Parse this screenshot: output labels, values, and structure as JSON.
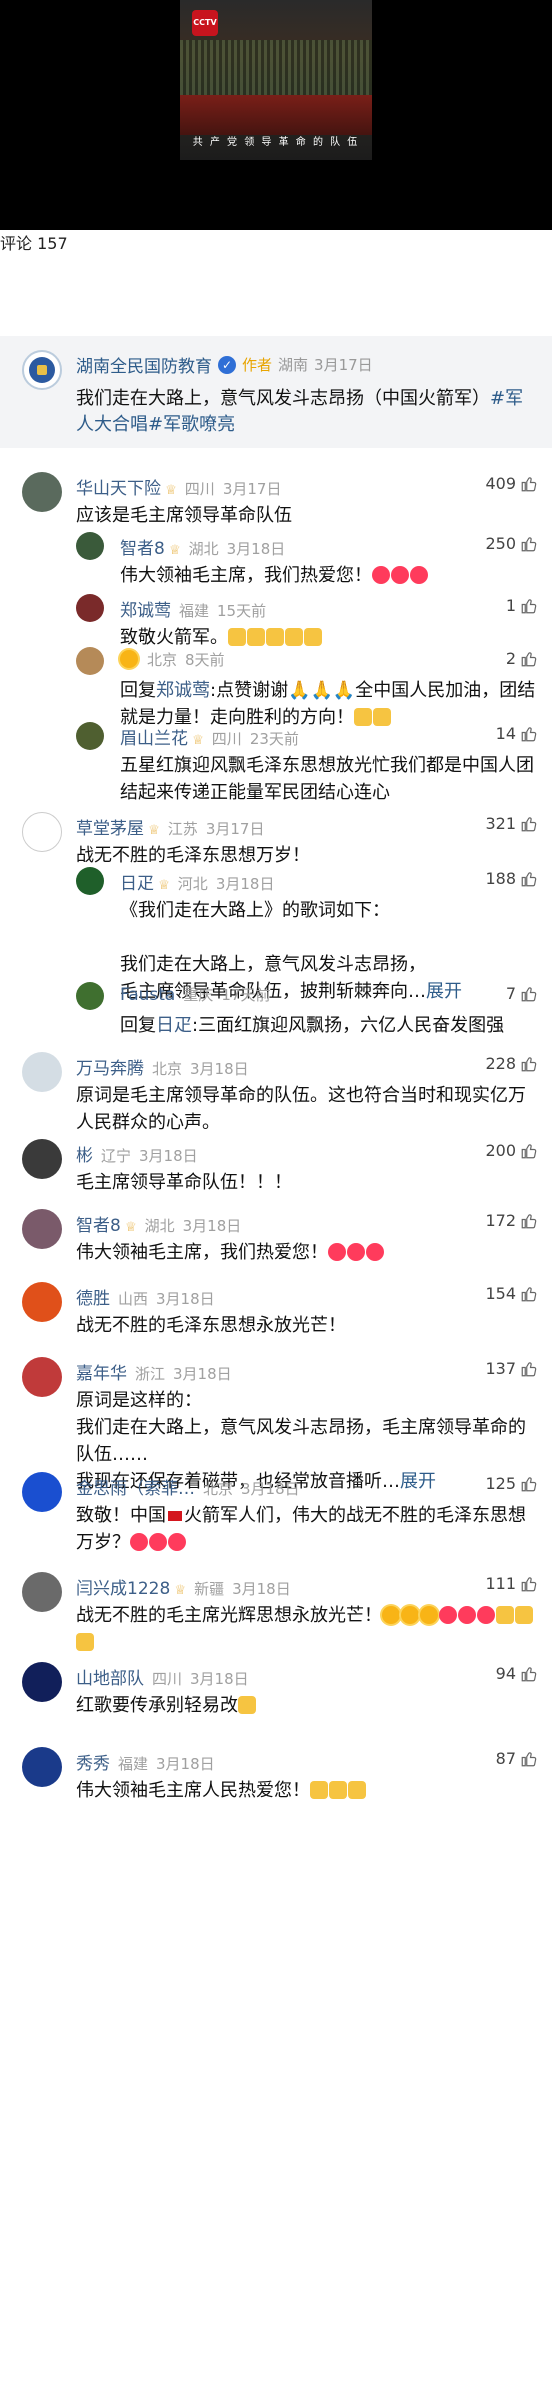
{
  "video": {
    "subtitle": "共 产 党 领 导 革 命 的 队 伍",
    "badge": "CCTV"
  },
  "header": {
    "title": "评论 157"
  },
  "author_post": {
    "name": "湖南全民国防教育",
    "tag": "作者",
    "location": "湖南",
    "date": "3月17日",
    "text": "我们走在大路上，意气风发斗志昂扬（中国火箭军）",
    "hashtags": "#军人大合唱#军歌嘹亮"
  },
  "comments": [
    {
      "name": "华山天下险",
      "crown": true,
      "location": "四川",
      "date": "3月17日",
      "likes": "409",
      "text": "应该是毛主席领导革命队伍",
      "level": 0
    },
    {
      "name": "智者8",
      "crown": true,
      "location": "湖北",
      "date": "3月18日",
      "likes": "250",
      "text": "伟大领袖毛主席，我们热爱您！",
      "emoji": [
        "heart",
        "heart",
        "heart"
      ],
      "level": 1
    },
    {
      "name": "郑诚莺",
      "crown": false,
      "location": "福建",
      "date": "15天前",
      "likes": "1",
      "text": "致敬火箭军。",
      "emoji": [
        "thumb",
        "thumb",
        "thumb",
        "thumb",
        "thumb"
      ],
      "level": 1
    },
    {
      "name": "",
      "crown": false,
      "location": "北京",
      "date": "8天前",
      "likes": "2",
      "text_prefix": "回复",
      "reply_to": "郑诚莺",
      "text": ":点赞谢谢🙏🙏🙏全中国人民加油，团结就是力量！走向胜利的方向！",
      "emoji": [
        "thumb",
        "thumb"
      ],
      "level": 1
    },
    {
      "name": "眉山兰花",
      "crown": true,
      "location": "四川",
      "date": "23天前",
      "likes": "14",
      "text": "五星红旗迎风飘毛泽东思想放光忙我们都是中国人团结起来传递正能量军民团结心连心",
      "level": 1
    },
    {
      "name": "草堂茅屋",
      "crown": true,
      "location": "江苏",
      "date": "3月17日",
      "likes": "321",
      "text": "战无不胜的毛泽东思想万岁！",
      "level": 0
    },
    {
      "name": "日疋",
      "crown": true,
      "location": "河北",
      "date": "3月18日",
      "likes": "188",
      "text_lines": [
        "《我们走在大路上》的歌词如下：",
        "",
        "我们走在大路上，意气风发斗志昂扬，",
        "毛主席领导革命队伍，披荆斩棘奔向…"
      ],
      "more": "展开",
      "level": 1
    },
    {
      "name": "Fausta",
      "crown": false,
      "location": "重庆",
      "date": "17天前",
      "likes": "7",
      "text_prefix": "回复",
      "reply_to": "日疋",
      "text": ":三面红旗迎风飘扬，六亿人民奋发图强",
      "level": 1
    },
    {
      "name": "万马奔腾",
      "crown": false,
      "location": "北京",
      "date": "3月18日",
      "likes": "228",
      "text": "原词是毛主席领导革命的队伍。这也符合当时和现实亿万人民群众的心声。",
      "level": 0
    },
    {
      "name": "彬",
      "crown": false,
      "location": "辽宁",
      "date": "3月18日",
      "likes": "200",
      "text": "毛主席领导革命队伍！！！",
      "level": 0
    },
    {
      "name": "智者8",
      "crown": true,
      "location": "湖北",
      "date": "3月18日",
      "likes": "172",
      "text": "伟大领袖毛主席，我们热爱您！",
      "emoji": [
        "heart",
        "heart",
        "heart"
      ],
      "level": 0
    },
    {
      "name": "德胜",
      "crown": false,
      "location": "山西",
      "date": "3月18日",
      "likes": "154",
      "text": "战无不胜的毛泽东思想永放光芒！",
      "level": 0
    },
    {
      "name": "嘉年华",
      "crown": false,
      "location": "浙江",
      "date": "3月18日",
      "likes": "137",
      "text_lines": [
        "原词是这样的：",
        "    我们走在大路上，意气风发斗志昂扬，毛主席领导革命的队伍……",
        "    我现在还保存着磁带，也经常放音播听…"
      ],
      "more": "展开",
      "level": 0
    },
    {
      "name": "金思雨（索菲…",
      "crown": false,
      "location": "北京",
      "date": "3月18日",
      "likes": "125",
      "text_before_flag": "致敬！中国",
      "text": "火箭军人们，伟大的战无不胜的毛泽东思想万岁？",
      "emoji": [
        "heart",
        "heart",
        "heart"
      ],
      "level": 0
    },
    {
      "name": "闫兴成1228",
      "crown": true,
      "location": "新疆",
      "date": "3月18日",
      "likes": "111",
      "text": "战无不胜的毛主席光辉思想永放光芒！",
      "emoji": [
        "sun",
        "sun",
        "sun",
        "heart",
        "heart",
        "heart",
        "thumb",
        "thumb",
        "thumb"
      ],
      "level": 0
    },
    {
      "name": "山地部队",
      "crown": false,
      "location": "四川",
      "date": "3月18日",
      "likes": "94",
      "text": "红歌要传承别轻易改",
      "emoji": [
        "thumb"
      ],
      "level": 0
    },
    {
      "name": "秀秀",
      "crown": false,
      "location": "福建",
      "date": "3月18日",
      "likes": "87",
      "text": "伟大领袖毛主席人民热爱您！",
      "emoji": [
        "thumb",
        "thumb",
        "thumb"
      ],
      "level": 0
    }
  ],
  "colors": {
    "link": "#3d5f88",
    "meta": "#a0a0a0",
    "author_tag": "#e8a400",
    "author_bg": "#f3f4f6"
  },
  "icons": {
    "like": "thumbs-up-outline-icon",
    "verified": "verified-badge-icon",
    "crown": "vip-crown-icon"
  }
}
